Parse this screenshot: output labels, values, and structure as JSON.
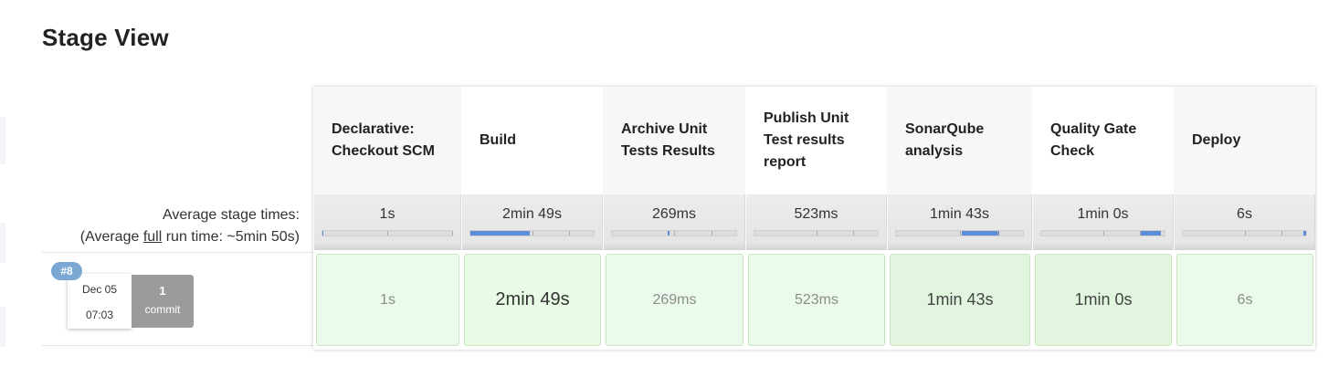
{
  "page": {
    "title": "Stage View"
  },
  "summary": {
    "avg_prefix": "Average stage times:",
    "full_prefix": "(Average ",
    "full_link": "full",
    "full_suffix": " run time: ~5min 50s)"
  },
  "run": {
    "number": "#8",
    "date": "Dec 05",
    "time": "07:03",
    "commit_count": "1",
    "commit_label": "commit"
  },
  "stages": [
    {
      "name": "Declarative: Checkout SCM",
      "avg": "1s",
      "run": "1s",
      "share": 0.003
    },
    {
      "name": "Build",
      "avg": "2min 49s",
      "run": "2min 49s",
      "share": 0.48
    },
    {
      "name": "Archive Unit Tests Results",
      "avg": "269ms",
      "run": "269ms",
      "share": 0.001
    },
    {
      "name": "Publish Unit Test results report",
      "avg": "523ms",
      "run": "523ms",
      "share": 0.002
    },
    {
      "name": "SonarQube analysis",
      "avg": "1min 43s",
      "run": "1min 43s",
      "share": 0.29
    },
    {
      "name": "Quality Gate Check",
      "avg": "1min 0s",
      "run": "1min 0s",
      "share": 0.17
    },
    {
      "name": "Deploy",
      "avg": "6s",
      "run": "6s",
      "share": 0.017
    }
  ],
  "colors": {
    "success_cell": "#e6f9e3",
    "bar_fill": "#5b8ed6",
    "badge": "#7ba7d3",
    "commit_badge": "#9b9b9b"
  }
}
